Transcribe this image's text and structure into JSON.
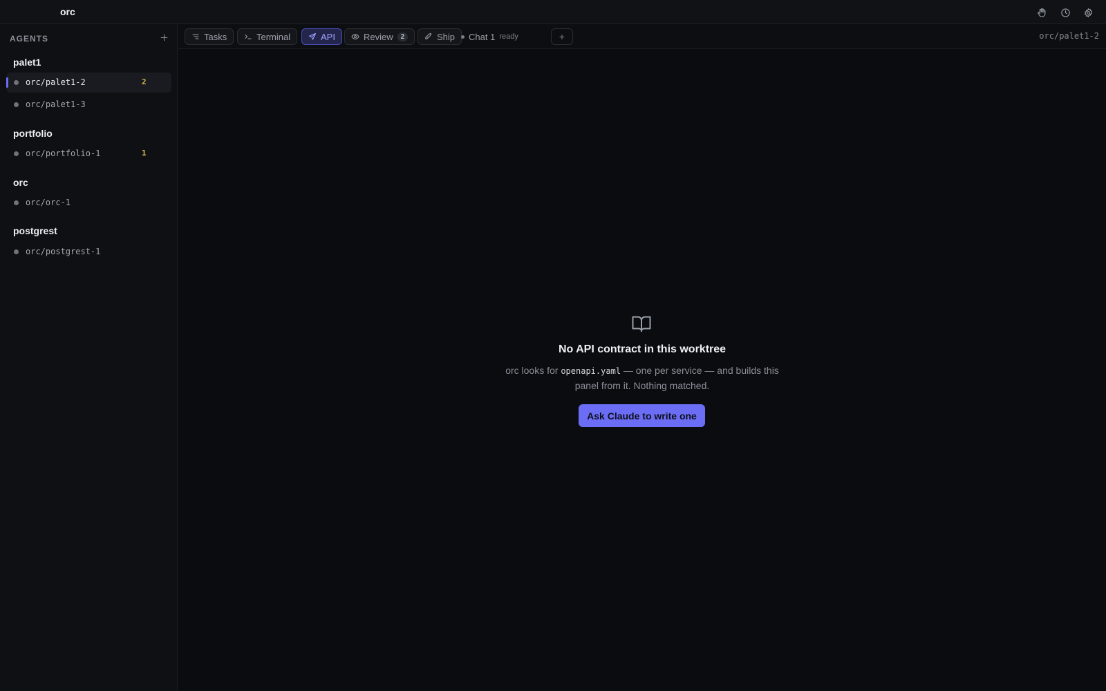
{
  "app": {
    "title": "orc"
  },
  "titlebar_icons": [
    "hand-icon",
    "clock-icon",
    "gear-icon"
  ],
  "sidebar": {
    "header": "AGENTS",
    "groups": [
      {
        "title": "palet1",
        "items": [
          {
            "name": "orc/palet1-2",
            "badge": "2",
            "active": true
          },
          {
            "name": "orc/palet1-3",
            "badge": ""
          }
        ]
      },
      {
        "title": "portfolio",
        "items": [
          {
            "name": "orc/portfolio-1",
            "badge": "1"
          }
        ]
      },
      {
        "title": "orc",
        "items": [
          {
            "name": "orc/orc-1",
            "badge": ""
          }
        ]
      },
      {
        "title": "postgrest",
        "items": [
          {
            "name": "orc/postgrest-1",
            "badge": ""
          }
        ]
      }
    ]
  },
  "tabs": {
    "tasks": "Tasks",
    "terminal": "Terminal",
    "api": "API",
    "review": "Review",
    "review_count": "2",
    "ship": "Ship",
    "chat": "Chat 1",
    "chat_status": "ready",
    "add": "+",
    "active": "API"
  },
  "branch": "orc/palet1-2",
  "empty_state": {
    "icon": "book-open-icon",
    "title": "No API contract in this worktree",
    "desc_prefix": "orc looks for ",
    "desc_code": "openapi.yaml",
    "desc_suffix": " — one per service — and builds this panel from it. Nothing matched.",
    "cta": "Ask Claude to write one"
  },
  "colors": {
    "accent": "#6b6ef5",
    "badge": "#d6b24a",
    "background": "#0b0c0f"
  }
}
